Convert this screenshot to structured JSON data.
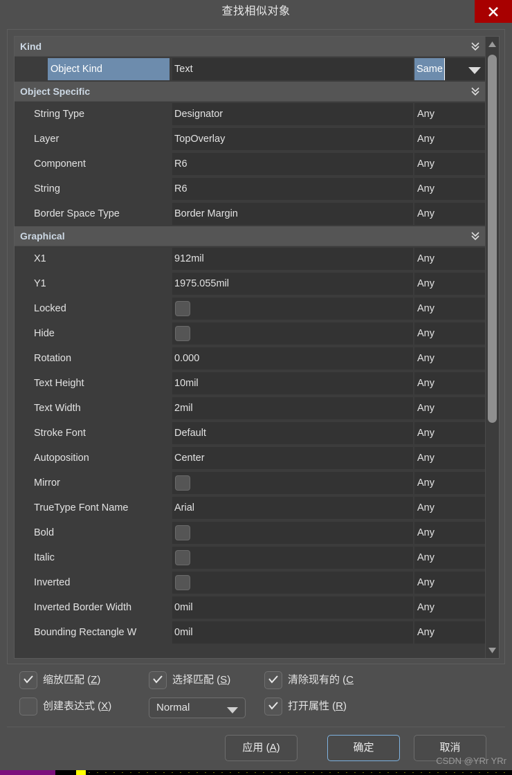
{
  "window": {
    "title": "查找相似对象",
    "close_icon": "close-x-icon"
  },
  "list": {
    "sections": [
      {
        "name": "Kind",
        "collapse_icon": "double-chevron-down-icon",
        "rows": [
          {
            "label": "Object Kind",
            "value": "Text",
            "match": "Same",
            "type": "dropdown",
            "selected": true
          }
        ]
      },
      {
        "name": "Object Specific",
        "collapse_icon": "double-chevron-down-icon",
        "rows": [
          {
            "label": "String Type",
            "value": "Designator",
            "match": "Any",
            "type": "text"
          },
          {
            "label": "Layer",
            "value": "TopOverlay",
            "match": "Any",
            "type": "text"
          },
          {
            "label": "Component",
            "value": "R6",
            "match": "Any",
            "type": "text"
          },
          {
            "label": "String",
            "value": "R6",
            "match": "Any",
            "type": "text"
          },
          {
            "label": "Border Space Type",
            "value": "Border Margin",
            "match": "Any",
            "type": "text"
          }
        ]
      },
      {
        "name": "Graphical",
        "collapse_icon": "double-chevron-down-icon",
        "rows": [
          {
            "label": "X1",
            "value": "912mil",
            "match": "Any",
            "type": "text"
          },
          {
            "label": "Y1",
            "value": "1975.055mil",
            "match": "Any",
            "type": "text"
          },
          {
            "label": "Locked",
            "value": "",
            "match": "Any",
            "type": "checkbox",
            "checked": false
          },
          {
            "label": "Hide",
            "value": "",
            "match": "Any",
            "type": "checkbox",
            "checked": false
          },
          {
            "label": "Rotation",
            "value": "0.000",
            "match": "Any",
            "type": "text"
          },
          {
            "label": "Text Height",
            "value": "10mil",
            "match": "Any",
            "type": "text"
          },
          {
            "label": "Text Width",
            "value": "2mil",
            "match": "Any",
            "type": "text"
          },
          {
            "label": "Stroke Font",
            "value": "Default",
            "match": "Any",
            "type": "text"
          },
          {
            "label": "Autoposition",
            "value": "Center",
            "match": "Any",
            "type": "text"
          },
          {
            "label": "Mirror",
            "value": "",
            "match": "Any",
            "type": "checkbox",
            "checked": false
          },
          {
            "label": "TrueType Font Name",
            "value": "Arial",
            "match": "Any",
            "type": "text"
          },
          {
            "label": "Bold",
            "value": "",
            "match": "Any",
            "type": "checkbox",
            "checked": false
          },
          {
            "label": "Italic",
            "value": "",
            "match": "Any",
            "type": "checkbox",
            "checked": false
          },
          {
            "label": "Inverted",
            "value": "",
            "match": "Any",
            "type": "checkbox",
            "checked": false
          },
          {
            "label": "Inverted Border Width",
            "value": "0mil",
            "match": "Any",
            "type": "text"
          },
          {
            "label": "Bounding Rectangle W",
            "value": "0mil",
            "match": "Any",
            "type": "text"
          }
        ]
      }
    ],
    "scrollbar": {
      "up_icon": "triangle-up-icon",
      "down_icon": "triangle-down-icon"
    }
  },
  "options": {
    "zoom_match": {
      "label": "缩放匹配 (",
      "mnemonic": "Z",
      "label_tail": ")",
      "checked": true
    },
    "select_match": {
      "label": "选择匹配 (",
      "mnemonic": "S",
      "label_tail": ")",
      "checked": true
    },
    "clear_existing": {
      "label": "清除现有的 (",
      "mnemonic": "C",
      "label_tail": "",
      "checked": true
    },
    "create_expression": {
      "label": "创建表达式 (",
      "mnemonic": "X",
      "label_tail": ")",
      "checked": false
    },
    "open_properties": {
      "label": "打开属性 (",
      "mnemonic": "R",
      "label_tail": ")",
      "checked": true
    },
    "mode_select": {
      "value": "Normal",
      "arrow_icon": "triangle-down-icon"
    }
  },
  "buttons": {
    "apply": {
      "label": "应用 (",
      "mnemonic": "A",
      "label_tail": ")"
    },
    "ok": {
      "label": "确定"
    },
    "cancel": {
      "label": "取消"
    }
  },
  "watermark": {
    "text": "CSDN @YRr YRr"
  }
}
